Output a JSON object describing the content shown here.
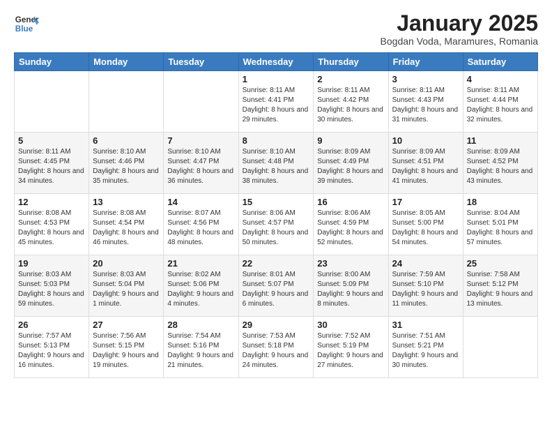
{
  "header": {
    "logo_line1": "General",
    "logo_line2": "Blue",
    "month": "January 2025",
    "location": "Bogdan Voda, Maramures, Romania"
  },
  "weekdays": [
    "Sunday",
    "Monday",
    "Tuesday",
    "Wednesday",
    "Thursday",
    "Friday",
    "Saturday"
  ],
  "weeks": [
    [
      {
        "day": "",
        "info": ""
      },
      {
        "day": "",
        "info": ""
      },
      {
        "day": "",
        "info": ""
      },
      {
        "day": "1",
        "info": "Sunrise: 8:11 AM\nSunset: 4:41 PM\nDaylight: 8 hours and 29 minutes."
      },
      {
        "day": "2",
        "info": "Sunrise: 8:11 AM\nSunset: 4:42 PM\nDaylight: 8 hours and 30 minutes."
      },
      {
        "day": "3",
        "info": "Sunrise: 8:11 AM\nSunset: 4:43 PM\nDaylight: 8 hours and 31 minutes."
      },
      {
        "day": "4",
        "info": "Sunrise: 8:11 AM\nSunset: 4:44 PM\nDaylight: 8 hours and 32 minutes."
      }
    ],
    [
      {
        "day": "5",
        "info": "Sunrise: 8:11 AM\nSunset: 4:45 PM\nDaylight: 8 hours and 34 minutes."
      },
      {
        "day": "6",
        "info": "Sunrise: 8:10 AM\nSunset: 4:46 PM\nDaylight: 8 hours and 35 minutes."
      },
      {
        "day": "7",
        "info": "Sunrise: 8:10 AM\nSunset: 4:47 PM\nDaylight: 8 hours and 36 minutes."
      },
      {
        "day": "8",
        "info": "Sunrise: 8:10 AM\nSunset: 4:48 PM\nDaylight: 8 hours and 38 minutes."
      },
      {
        "day": "9",
        "info": "Sunrise: 8:09 AM\nSunset: 4:49 PM\nDaylight: 8 hours and 39 minutes."
      },
      {
        "day": "10",
        "info": "Sunrise: 8:09 AM\nSunset: 4:51 PM\nDaylight: 8 hours and 41 minutes."
      },
      {
        "day": "11",
        "info": "Sunrise: 8:09 AM\nSunset: 4:52 PM\nDaylight: 8 hours and 43 minutes."
      }
    ],
    [
      {
        "day": "12",
        "info": "Sunrise: 8:08 AM\nSunset: 4:53 PM\nDaylight: 8 hours and 45 minutes."
      },
      {
        "day": "13",
        "info": "Sunrise: 8:08 AM\nSunset: 4:54 PM\nDaylight: 8 hours and 46 minutes."
      },
      {
        "day": "14",
        "info": "Sunrise: 8:07 AM\nSunset: 4:56 PM\nDaylight: 8 hours and 48 minutes."
      },
      {
        "day": "15",
        "info": "Sunrise: 8:06 AM\nSunset: 4:57 PM\nDaylight: 8 hours and 50 minutes."
      },
      {
        "day": "16",
        "info": "Sunrise: 8:06 AM\nSunset: 4:59 PM\nDaylight: 8 hours and 52 minutes."
      },
      {
        "day": "17",
        "info": "Sunrise: 8:05 AM\nSunset: 5:00 PM\nDaylight: 8 hours and 54 minutes."
      },
      {
        "day": "18",
        "info": "Sunrise: 8:04 AM\nSunset: 5:01 PM\nDaylight: 8 hours and 57 minutes."
      }
    ],
    [
      {
        "day": "19",
        "info": "Sunrise: 8:03 AM\nSunset: 5:03 PM\nDaylight: 8 hours and 59 minutes."
      },
      {
        "day": "20",
        "info": "Sunrise: 8:03 AM\nSunset: 5:04 PM\nDaylight: 9 hours and 1 minute."
      },
      {
        "day": "21",
        "info": "Sunrise: 8:02 AM\nSunset: 5:06 PM\nDaylight: 9 hours and 4 minutes."
      },
      {
        "day": "22",
        "info": "Sunrise: 8:01 AM\nSunset: 5:07 PM\nDaylight: 9 hours and 6 minutes."
      },
      {
        "day": "23",
        "info": "Sunrise: 8:00 AM\nSunset: 5:09 PM\nDaylight: 9 hours and 8 minutes."
      },
      {
        "day": "24",
        "info": "Sunrise: 7:59 AM\nSunset: 5:10 PM\nDaylight: 9 hours and 11 minutes."
      },
      {
        "day": "25",
        "info": "Sunrise: 7:58 AM\nSunset: 5:12 PM\nDaylight: 9 hours and 13 minutes."
      }
    ],
    [
      {
        "day": "26",
        "info": "Sunrise: 7:57 AM\nSunset: 5:13 PM\nDaylight: 9 hours and 16 minutes."
      },
      {
        "day": "27",
        "info": "Sunrise: 7:56 AM\nSunset: 5:15 PM\nDaylight: 9 hours and 19 minutes."
      },
      {
        "day": "28",
        "info": "Sunrise: 7:54 AM\nSunset: 5:16 PM\nDaylight: 9 hours and 21 minutes."
      },
      {
        "day": "29",
        "info": "Sunrise: 7:53 AM\nSunset: 5:18 PM\nDaylight: 9 hours and 24 minutes."
      },
      {
        "day": "30",
        "info": "Sunrise: 7:52 AM\nSunset: 5:19 PM\nDaylight: 9 hours and 27 minutes."
      },
      {
        "day": "31",
        "info": "Sunrise: 7:51 AM\nSunset: 5:21 PM\nDaylight: 9 hours and 30 minutes."
      },
      {
        "day": "",
        "info": ""
      }
    ]
  ]
}
